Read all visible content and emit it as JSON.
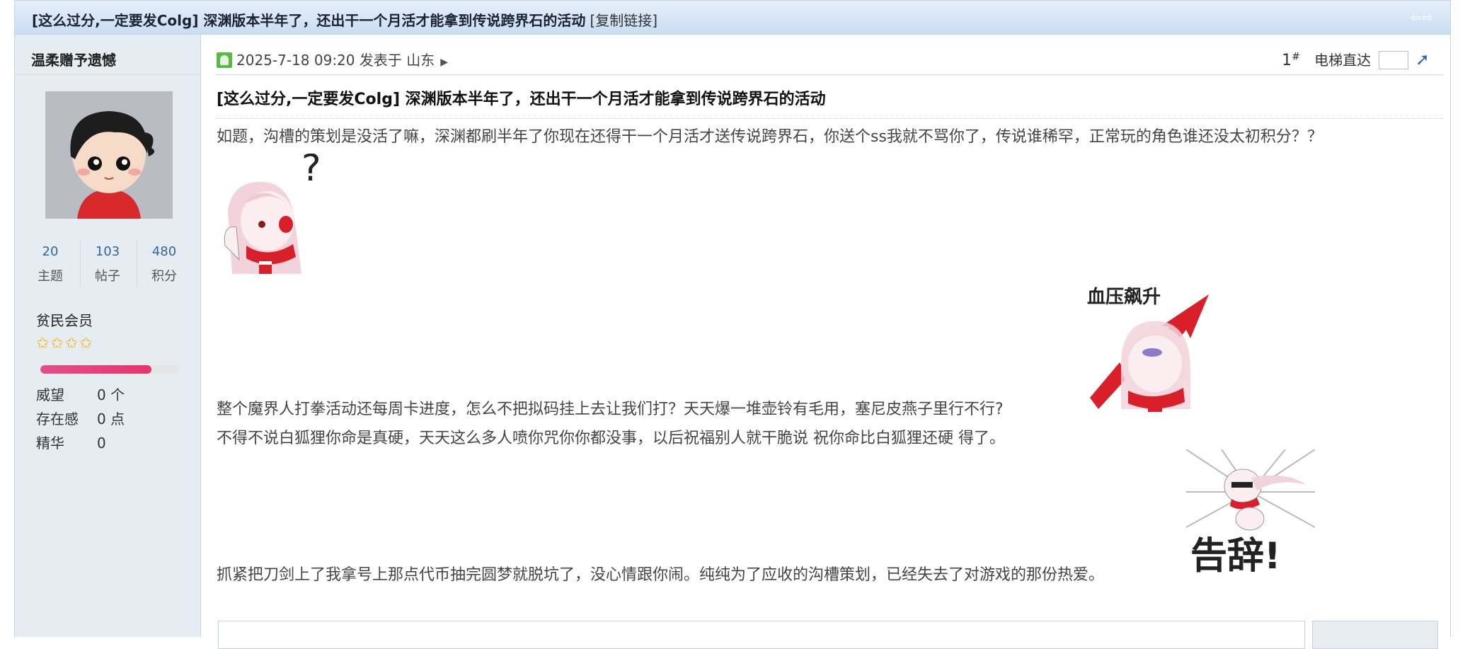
{
  "thread": {
    "title": "[这么过分,一定要发Colg] 深渊版本半年了，还出干一个月活才能拿到传说跨界石的活动",
    "copy_link": "[复制链接]"
  },
  "author": {
    "name": "温柔赠予遗憾",
    "stats": [
      {
        "value": "20",
        "label": "主题"
      },
      {
        "value": "103",
        "label": "帖子"
      },
      {
        "value": "480",
        "label": "积分"
      }
    ],
    "group": "贫民会员",
    "stars": "✩✩✩✩",
    "level_progress": 0.8,
    "props": [
      {
        "label": "威望",
        "value": "0 个"
      },
      {
        "label": "存在感",
        "value": "0 点"
      },
      {
        "label": "精华",
        "value": "0"
      }
    ]
  },
  "post": {
    "date_line": "2025-7-18 09:20 发表于 山东",
    "floor_num": "1",
    "floor_mark": "#",
    "elevator_label": "电梯直达",
    "title": "[这么过分,一定要发Colg] 深渊版本半年了，还出干一个月活才能拿到传说跨界石的活动",
    "paragraphs": [
      "如题，沟槽的策划是没活了嘛，深渊都刷半年了你现在还得干一个月活才送传说跨界石，你送个ss我就不骂你了，传说谁稀罕，正常玩的角色谁还没太初积分？？",
      "整个魔界人打拳活动还每周卡进度，怎么不把拟码挂上去让我们打？天天爆一堆壶铃有毛用，塞尼皮燕子里行不行?",
      "不得不说白狐狸你命是真硬，天天这么多人喷你咒你你都没事，以后祝福别人就干脆说 祝你命比白狐狸还硬  得了。",
      "抓紧把刀剑上了我拿号上那点代币抽完圆梦就脱坑了，没心情跟你闹。纯纯为了应收的沟槽策划，已经失去了对游戏的那份热爱。"
    ],
    "sticker_texts": {
      "pressure": "血压飙升",
      "bye": "告辞!"
    }
  },
  "colors": {
    "accent": "#336699",
    "header_bg": "#c9ddf2",
    "sidebar_bg": "#e5edf2",
    "online": "#58b944"
  }
}
